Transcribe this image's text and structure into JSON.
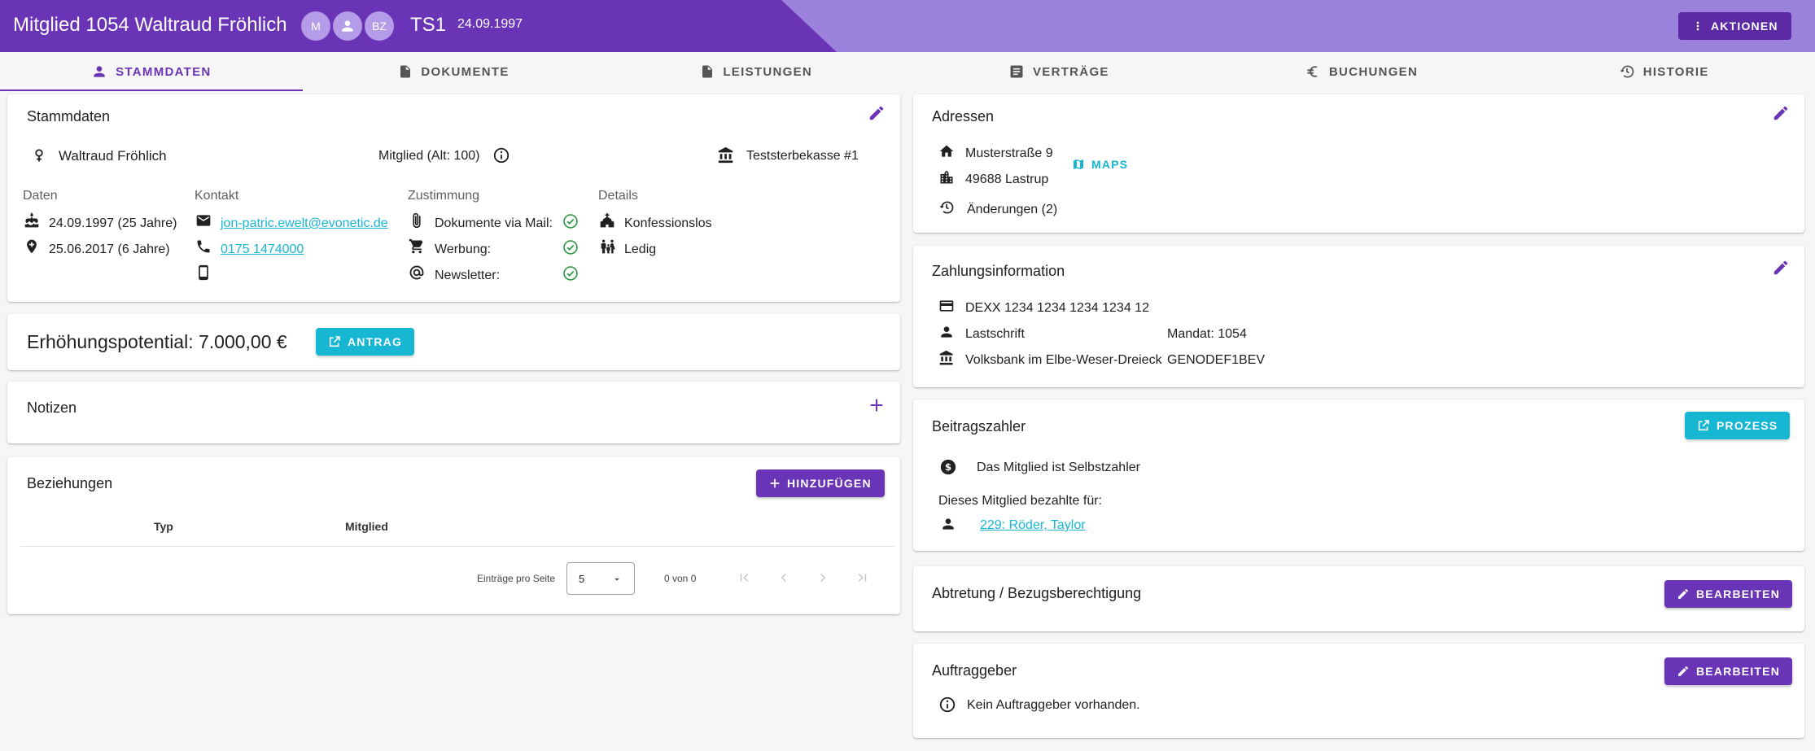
{
  "header": {
    "title": "Mitglied 1054 Waltraud Fröhlich",
    "avatars": [
      "M",
      "",
      "BZ"
    ],
    "code": "TS1",
    "date": "24.09.1997",
    "actions_label": "AKTIONEN"
  },
  "tabs": [
    {
      "label": "STAMMDATEN",
      "icon": "person-icon",
      "active": true
    },
    {
      "label": "DOKUMENTE",
      "icon": "document-icon"
    },
    {
      "label": "LEISTUNGEN",
      "icon": "document-icon"
    },
    {
      "label": "VERTRÄGE",
      "icon": "contract-icon"
    },
    {
      "label": "BUCHUNGEN",
      "icon": "euro-icon"
    },
    {
      "label": "HISTORIE",
      "icon": "history-icon"
    }
  ],
  "stammdaten": {
    "title": "Stammdaten",
    "name": "Waltraud Fröhlich",
    "membership": "Mitglied (Alt: 100)",
    "kasse": "Teststerbekasse #1",
    "col_headers": {
      "daten": "Daten",
      "kontakt": "Kontakt",
      "zustimmung": "Zustimmung",
      "details": "Details"
    },
    "daten": [
      "24.09.1997 (25 Jahre)",
      "25.06.2017 (6 Jahre)"
    ],
    "kontakt": {
      "email": "jon-patric.ewelt@evonetic.de",
      "phone": "0175 1474000",
      "mobile": ""
    },
    "zustimmung": [
      "Dokumente via Mail:",
      "Werbung:",
      "Newsletter:"
    ],
    "details": [
      "Konfessionslos",
      "Ledig"
    ]
  },
  "erhoehung": {
    "text": "Erhöhungspotential: 7.000,00 €",
    "button": "ANTRAG"
  },
  "notizen": {
    "title": "Notizen"
  },
  "beziehungen": {
    "title": "Beziehungen",
    "button": "HINZUFÜGEN",
    "columns": [
      "Typ",
      "Mitglied"
    ],
    "page_size_label": "Einträge pro Seite",
    "page_size": "5",
    "range": "0 von 0"
  },
  "adressen": {
    "title": "Adressen",
    "street": "Musterstraße 9",
    "city": "49688 Lastrup",
    "maps": "MAPS",
    "changes": "Änderungen (2)"
  },
  "zahlung": {
    "title": "Zahlungsinformation",
    "iban": "DEXX 1234 1234 1234 1234 12",
    "method": "Lastschrift",
    "mandate": "Mandat: 1054",
    "bank": "Volksbank im Elbe-Weser-Dreieck",
    "bic": "GENODEF1BEV"
  },
  "beitragszahler": {
    "title": "Beitragszahler",
    "button": "PROZESS",
    "self": "Das Mitglied ist Selbstzahler",
    "paid_for": "Dieses Mitglied bezahlte für:",
    "link": "229: Röder, Taylor"
  },
  "abtretung": {
    "title": "Abtretung / Bezugsberechtigung",
    "button": "BEARBEITEN"
  },
  "auftraggeber": {
    "title": "Auftraggeber",
    "button": "BEARBEITEN",
    "empty": "Kein Auftraggeber vorhanden."
  },
  "colors": {
    "primary": "#6a34b6",
    "header_light": "#9d82dd",
    "accent": "#17b6d2",
    "success": "#2e9a48"
  }
}
